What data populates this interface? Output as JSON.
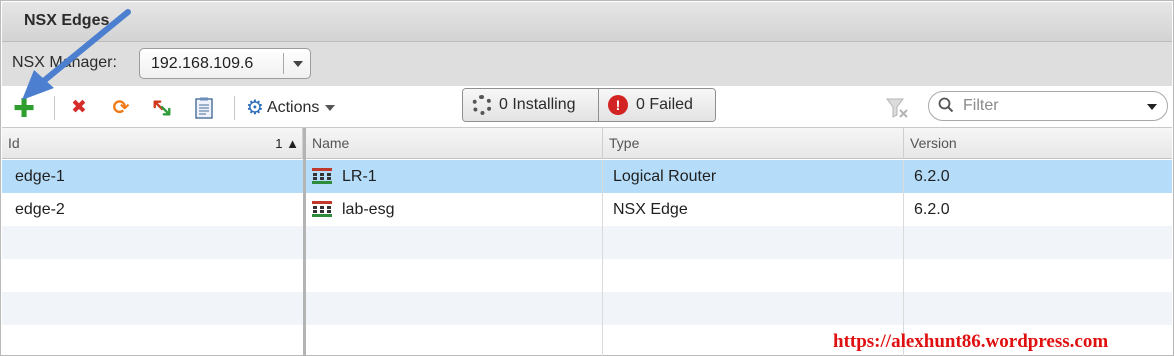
{
  "window": {
    "title": "NSX Edges"
  },
  "manager": {
    "label": "NSX Manager:",
    "value": "192.168.109.6"
  },
  "toolbar": {
    "icons": [
      "add-icon",
      "delete-icon",
      "refresh-icon",
      "import-export-icon",
      "report-icon"
    ],
    "actions_label": "Actions",
    "installing_label": "0 Installing",
    "failed_label": "0 Failed",
    "filter_placeholder": "Filter"
  },
  "left_grid": {
    "columns": [
      {
        "label": "Id",
        "sort_index": "1"
      }
    ],
    "rows": [
      {
        "id": "edge-1",
        "selected": true
      },
      {
        "id": "edge-2",
        "selected": false
      }
    ]
  },
  "right_grid": {
    "columns": [
      "Name",
      "Type",
      "Version"
    ],
    "rows": [
      {
        "name": "LR-1",
        "type": "Logical Router",
        "version": "6.2.0",
        "selected": true
      },
      {
        "name": "lab-esg",
        "type": "NSX Edge",
        "version": "6.2.0",
        "selected": false
      }
    ]
  },
  "watermark": "https://alexhunt86.wordpress.com",
  "colors": {
    "selection": "#b5dcf9",
    "add_green": "#2e9e2e",
    "delete_red": "#d42b2b",
    "refresh_orange": "#f07a16",
    "accent_blue": "#2f6fb9",
    "watermark_red": "#e01010",
    "annotation_arrow": "#4c7fd0"
  }
}
